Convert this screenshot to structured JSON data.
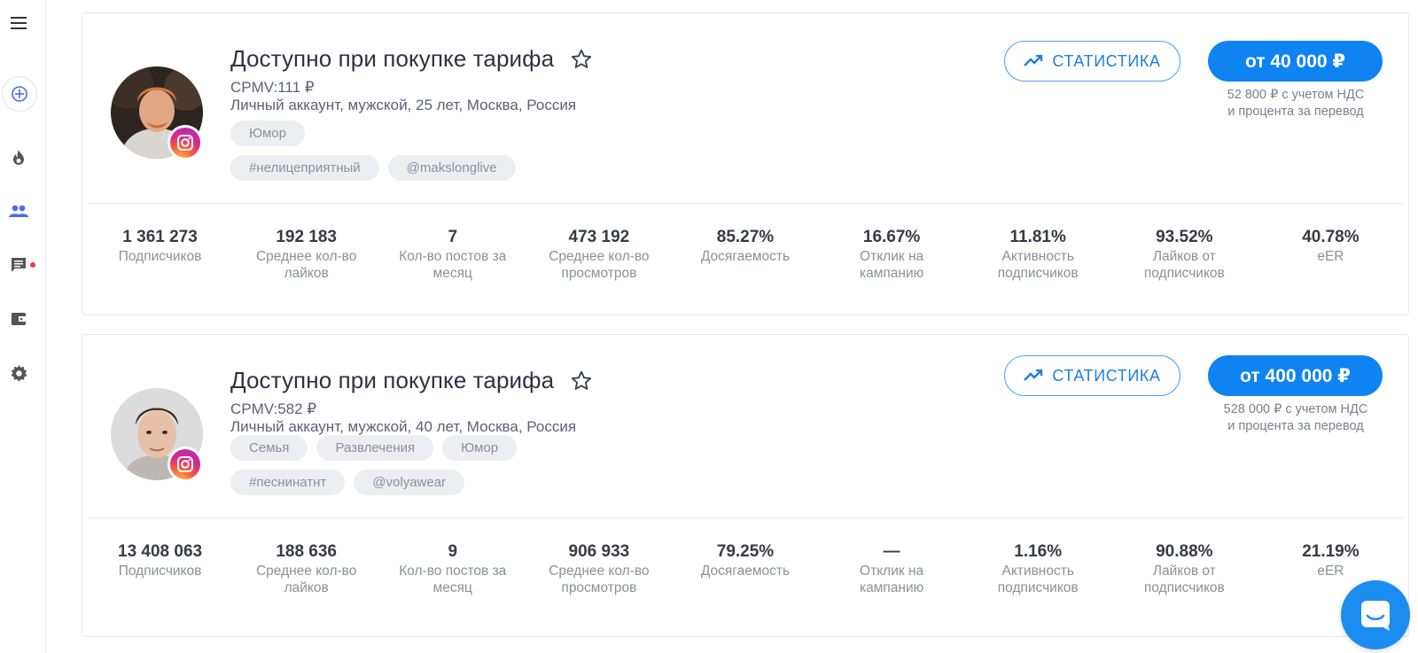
{
  "sidebar": {
    "items": [
      {
        "icon": "menu-icon"
      },
      {
        "icon": "add-circle-icon"
      },
      {
        "icon": "fire-icon"
      },
      {
        "icon": "people-icon"
      },
      {
        "icon": "chat-icon",
        "has_notification": true
      },
      {
        "icon": "wallet-icon"
      },
      {
        "icon": "gear-icon"
      }
    ],
    "accent_color": "#4a6cf7",
    "notification_color": "#f0334a"
  },
  "cards": [
    {
      "title": "Доступно при покупке тарифа",
      "cpmv": "CPMV:111 ₽",
      "description": "Личный аккаунт, мужской, 25 лет, Москва, Россия",
      "categories": [
        "Юмор"
      ],
      "tags": [
        "#нелицеприятный",
        "@makslonglive"
      ],
      "statistics_label": "СТАТИСТИКА",
      "price_label": "от 40 000 ₽",
      "price_note": "52 800 ₽ с учетом НДС\nи процента за перевод",
      "stats": [
        {
          "value": "1 361 273",
          "label": "Подписчиков"
        },
        {
          "value": "192 183",
          "label": "Среднее кол-во\nлайков"
        },
        {
          "value": "7",
          "label": "Кол-во постов за\nмесяц"
        },
        {
          "value": "473 192",
          "label": "Среднее кол-во\nпросмотров"
        },
        {
          "value": "85.27%",
          "label": "Досягаемость"
        },
        {
          "value": "16.67%",
          "label": "Отклик на\nкампанию"
        },
        {
          "value": "11.81%",
          "label": "Активность\nподписчиков"
        },
        {
          "value": "93.52%",
          "label": "Лайков от\nподписчиков"
        },
        {
          "value": "40.78%",
          "label": "eER"
        }
      ]
    },
    {
      "title": "Доступно при покупке тарифа",
      "cpmv": "CPMV:582 ₽",
      "description": "Личный аккаунт, мужской, 40 лет, Москва, Россия",
      "categories": [
        "Семья",
        "Развлечения",
        "Юмор"
      ],
      "tags": [
        "#песнинатнт",
        "@volyawear"
      ],
      "statistics_label": "СТАТИСТИКА",
      "price_label": "от 400 000 ₽",
      "price_note": "528 000 ₽ с учетом НДС\nи процента за перевод",
      "stats": [
        {
          "value": "13 408 063",
          "label": "Подписчиков"
        },
        {
          "value": "188 636",
          "label": "Среднее кол-во\nлайков"
        },
        {
          "value": "9",
          "label": "Кол-во постов за\nмесяц"
        },
        {
          "value": "906 933",
          "label": "Среднее кол-во\nпросмотров"
        },
        {
          "value": "79.25%",
          "label": "Досягаемость"
        },
        {
          "value": "—",
          "label": "Отклик на\nкампанию"
        },
        {
          "value": "1.16%",
          "label": "Активность\nподписчиков"
        },
        {
          "value": "90.88%",
          "label": "Лайков от\nподписчиков"
        },
        {
          "value": "21.19%",
          "label": "eER"
        }
      ]
    }
  ],
  "colors": {
    "primary": "#1083f3",
    "chip_bg": "#eceef2"
  }
}
